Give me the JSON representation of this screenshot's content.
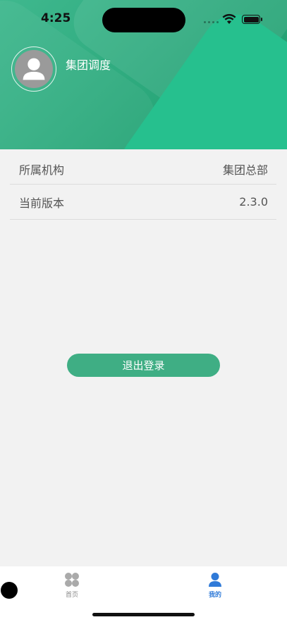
{
  "status_bar": {
    "time": "4:25"
  },
  "profile": {
    "name": "集团调度"
  },
  "info_rows": [
    {
      "label": "所属机构",
      "value": "集团总部"
    },
    {
      "label": "当前版本",
      "value": "2.3.0"
    }
  ],
  "logout_label": "退出登录",
  "tabbar": {
    "items": [
      {
        "label": "首页",
        "icon": "grid-icon",
        "active": false
      },
      {
        "label": "我的",
        "icon": "user-icon",
        "active": true
      }
    ]
  },
  "colors": {
    "header_green": "#2aa77a",
    "button_green": "#3fae84",
    "active_tab": "#2f7ad8",
    "background": "#f2f2f2"
  }
}
